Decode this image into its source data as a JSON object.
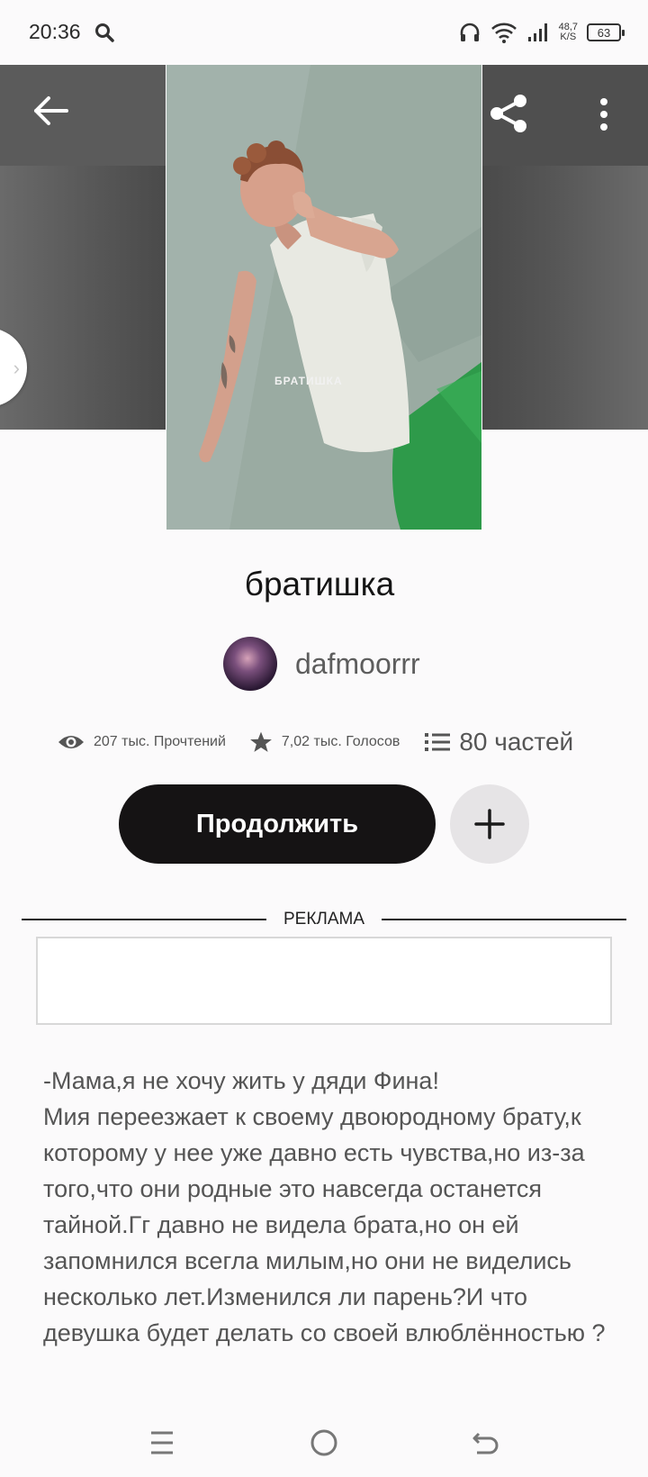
{
  "status_bar": {
    "time": "20:36",
    "net_speed_value": "48,7",
    "net_speed_unit": "K/S",
    "battery": "63"
  },
  "cover": {
    "overlay_text": "БРАТИШКА"
  },
  "story": {
    "title": "братишка",
    "author": "dafmoorrr",
    "reads": "207 тыс. Прочтений",
    "votes": "7,02 тыс. Голосов",
    "parts": "80 частей",
    "continue_label": "Продолжить",
    "description": "-Мама,я не хочу жить у дяди Фина!\nМия переезжает к своему двоюродному брату,к которому у нее уже давно есть чувства,но из-за того,что они родные это навсегда останется тайной.Гг давно не видела брата,но он ей запомнился всегла милым,но они не виделись несколько лет.Изменился ли парень?И что девушка будет делать со своей влюблённостью ?"
  },
  "ad": {
    "label": "РЕКЛАМА"
  },
  "colors": {
    "continue_bg": "#151314",
    "add_bg": "#e6e4e6",
    "cover_bg": "#9aaba2",
    "pants_green": "#2e9a4a"
  },
  "icons": [
    "search-icon",
    "headphones-icon",
    "wifi-icon",
    "signal-icon",
    "battery-icon",
    "back-arrow-icon",
    "share-icon",
    "more-vert-icon",
    "chevron-right-icon",
    "eye-icon",
    "star-icon",
    "list-icon",
    "plus-icon",
    "menu-icon",
    "home-circle-icon",
    "back-nav-icon"
  ]
}
